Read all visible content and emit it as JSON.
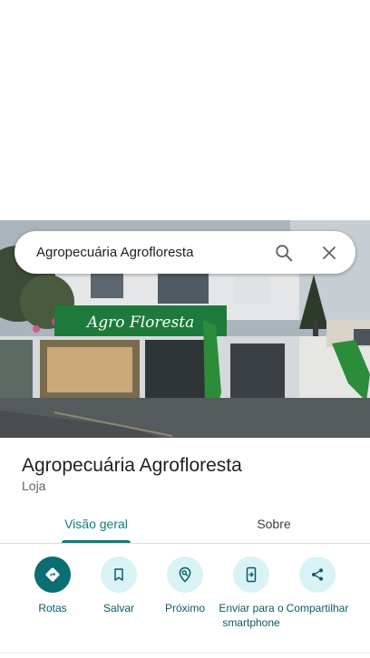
{
  "search": {
    "query": "Agropecuária Agrofloresta",
    "search_icon": "search-icon",
    "close_icon": "close-icon"
  },
  "photo": {
    "storefront_sign": "Agro Floresta",
    "description_icon": "storefront-photo"
  },
  "place": {
    "name": "Agropecuária Agrofloresta",
    "category": "Loja"
  },
  "tabs": [
    {
      "label": "Visão geral",
      "active": true
    },
    {
      "label": "Sobre",
      "active": false
    }
  ],
  "actions": [
    {
      "label": "Rotas",
      "icon": "directions-icon"
    },
    {
      "label": "Salvar",
      "icon": "bookmark-icon"
    },
    {
      "label": "Próximo",
      "icon": "nearby-icon"
    },
    {
      "label": "Enviar para o smartphone",
      "icon": "send-to-phone-icon"
    },
    {
      "label": "Compartilhar",
      "icon": "share-icon"
    }
  ],
  "colors": {
    "accent": "#0b7d7d",
    "primary_action": "#0b6e72",
    "action_bg": "#d9f2f6",
    "sign_green": "#1e7a3c"
  }
}
